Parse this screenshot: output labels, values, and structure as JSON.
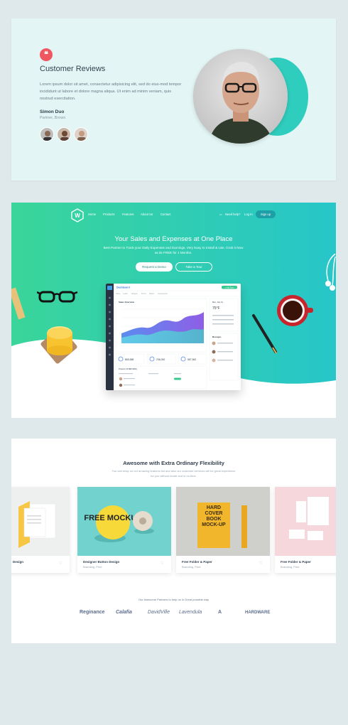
{
  "reviews": {
    "quote_icon": "quote-icon",
    "title": "Customer Reviews",
    "body": "Lorem ipsum dolor sit amet, consectetur adipisicing elit, sed do eius-mod tempor incididunt ut labore et dolore magna aliqua. Ut enim ad minim veniam, quis nostrud exercitation.",
    "name": "Simon Duo",
    "role": "Partner, Brown",
    "colors": {
      "accent": "#f0565f",
      "teal": "#2fcdbd",
      "bg": "#e3f6f5"
    }
  },
  "hero": {
    "nav": {
      "home": "Home",
      "products": "Products",
      "features": "Features",
      "about": "About Us",
      "contact": "Contact",
      "help": "Need help?",
      "login": "Log In",
      "signup": "Sign up"
    },
    "title": "Your Sales and Expenses at One Place",
    "subtitle": "Best Partner to Track your Daily Expenses and Earnings, Very Easy to Install & Use, Grab it Now as its FREE for 1 Months.",
    "cta_primary": "Request a Demo",
    "cta_secondary": "Take a Tour",
    "dashboard": {
      "brand": "Dashboard",
      "sales_title": "Sales Overview",
      "stat1": "$65,558",
      "stat2": "236,000",
      "stat3": "587,562",
      "weather": "75°F",
      "date": "Mon, July 14",
      "messages": "Messages",
      "projects": "Projects (OVERVIEW)",
      "add_button": "+ Add Team"
    },
    "colors": {
      "green": "#3ad59a",
      "teal": "#27c6c9"
    }
  },
  "portfolio": {
    "title": "Awesome with Extra Ordinary Flexibility",
    "subtitle": "You can relay on our amazing features list and also our customer services will be great experience for you without doubt and in no-time.",
    "cards": [
      {
        "name": "Design",
        "category": ""
      },
      {
        "name": "Designer Button Design",
        "category": "Branding, Print"
      },
      {
        "name": "Free Folder & Paper",
        "category": "Branding, Print"
      },
      {
        "name": "Free Folder & Paper",
        "category": "Branding, Print"
      }
    ],
    "book_text": "HARD COVER BOOK MOCK-UP",
    "button_text": "FREE MOCKUP",
    "partners_caption": "Our Awesome Partners to help us in Great possible way",
    "partners": [
      "Reginance",
      "Calafia",
      "DavidVille",
      "Lavendula",
      "A",
      "HARDWARE"
    ]
  }
}
